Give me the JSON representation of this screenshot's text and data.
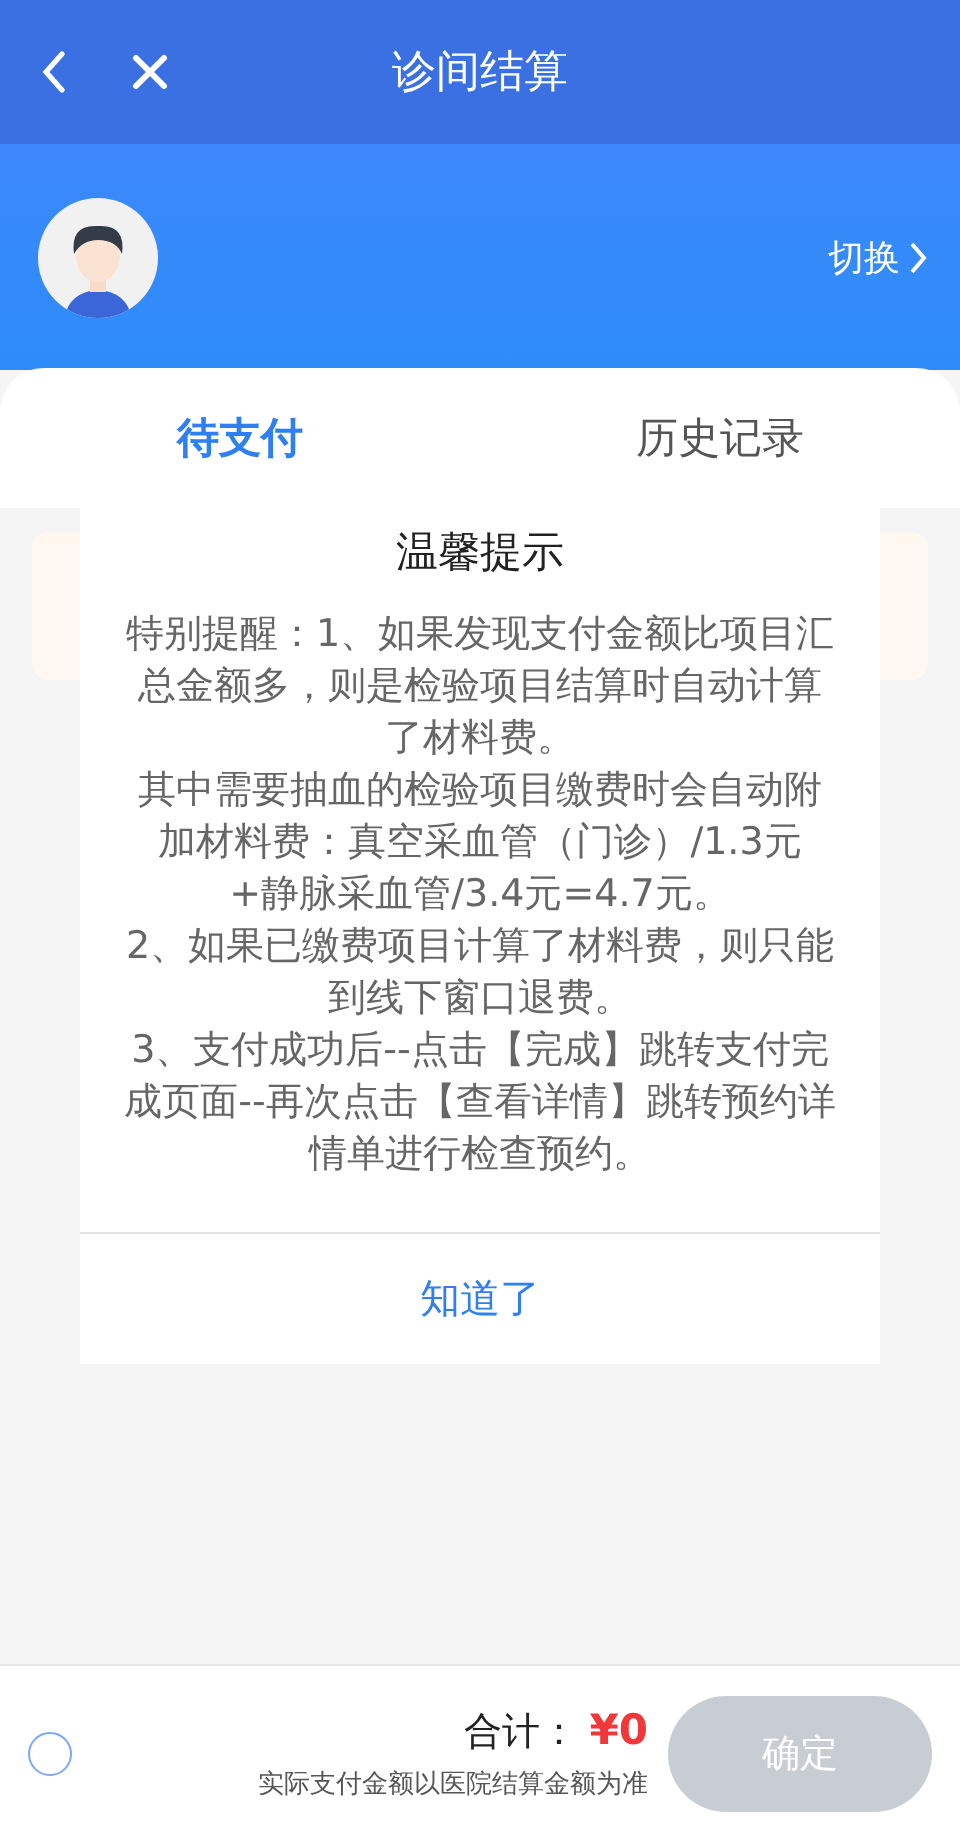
{
  "nav_bar": {
    "title": "诊间结算"
  },
  "patient": {
    "switch_label": "切换"
  },
  "tabs": [
    {
      "label": "待支付",
      "selected": true
    },
    {
      "label": "历史记录",
      "selected": false
    }
  ],
  "dialog": {
    "title": "温馨提示",
    "paragraphs": [
      "特别提醒：1、如果发现支付金额比项目汇总金额多，则是检验项目结算时自动计算了材料费。",
      "其中需要抽血的检验项目缴费时会自动附加材料费：真空采血管（门诊）/1.3元+静脉采血管/3.4元=4.7元。",
      "2、如果已缴费项目计算了材料费，则只能到线下窗口退费。",
      "3、支付成功后--点击【完成】跳转支付完成页面--再次点击【查看详情】跳转预约详情单进行检查预约。"
    ],
    "confirm": "知道了"
  },
  "footer": {
    "select_all": {
      "checked": false
    },
    "total_label": "合计：",
    "total_value": "¥0",
    "note": "实际支付金额以医院结算金额为准",
    "confirm": {
      "label": "确定",
      "disabled": true
    }
  }
}
